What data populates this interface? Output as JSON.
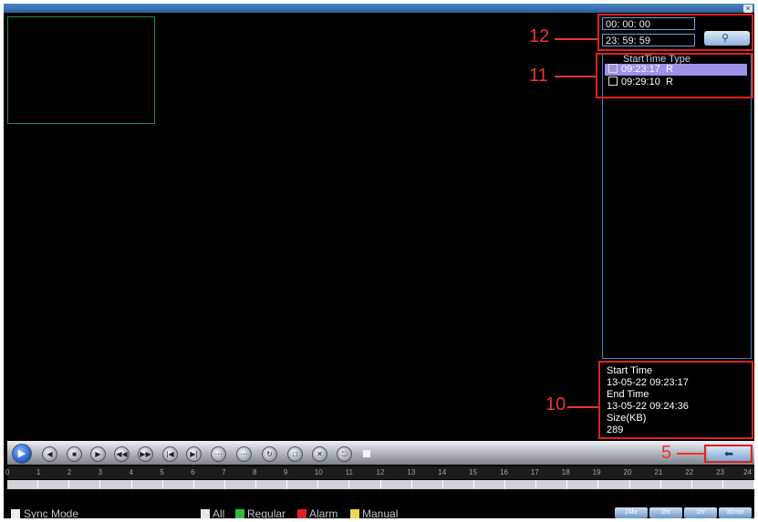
{
  "window": {
    "close_glyph": "×"
  },
  "search": {
    "start_time": "00: 00: 00",
    "end_time": "23: 59: 59",
    "search_icon": "magnifier-icon"
  },
  "file_list": {
    "header": "StartTime Type",
    "rows": [
      {
        "time": "09:23:17",
        "type": "R",
        "selected": true
      },
      {
        "time": "09:29:10",
        "type": "R",
        "selected": false
      }
    ]
  },
  "info": {
    "start_label": "Start Time",
    "start_value": "13-05-22 09:23:17",
    "end_label": "End Time",
    "end_value": "13-05-22 09:24:36",
    "size_label": "Size(KB)",
    "size_value": "289"
  },
  "callouts": {
    "c12": "12",
    "c11": "11",
    "c10": "10",
    "c5": "5"
  },
  "controls": {
    "buttons": [
      "play",
      "step-back",
      "stop",
      "step-forward",
      "rewind",
      "fast-forward",
      "previous-file",
      "next-file",
      "slow-backward",
      "slow-forward",
      "loop",
      "snapshot",
      "cut",
      "backup"
    ],
    "back_icon": "back-arrow-icon"
  },
  "timeline": {
    "ticks": [
      "0",
      "1",
      "2",
      "3",
      "4",
      "5",
      "6",
      "7",
      "8",
      "9",
      "10",
      "11",
      "12",
      "13",
      "14",
      "15",
      "16",
      "17",
      "18",
      "19",
      "20",
      "21",
      "22",
      "23",
      "24"
    ]
  },
  "footer": {
    "sync_mode": "Sync Mode",
    "legend": [
      {
        "label": "All",
        "color": "#e8e8e8"
      },
      {
        "label": "Regular",
        "color": "#2fbf3a"
      },
      {
        "label": "Alarm",
        "color": "#e02020"
      },
      {
        "label": "Manual",
        "color": "#e8d84a"
      }
    ],
    "zoom": [
      "24hr",
      "2hr",
      "1hr",
      "30min"
    ]
  },
  "colors": {
    "accent": "#4a86c8",
    "callout": "#e33333",
    "selected_row": "#9a93e8"
  }
}
